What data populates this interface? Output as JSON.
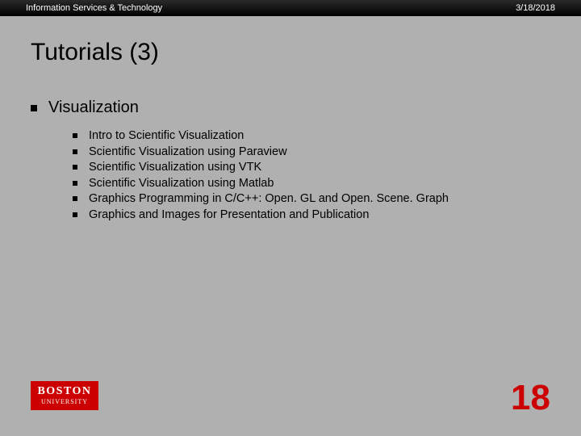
{
  "header": {
    "left": "Information Services & Technology",
    "right": "3/18/2018"
  },
  "title": "Tutorials (3)",
  "section": {
    "heading": "Visualization",
    "items": [
      "Intro to Scientific Visualization",
      "Scientific Visualization using Paraview",
      "Scientific Visualization using VTK",
      "Scientific Visualization using Matlab",
      "Graphics Programming in C/C++: Open. GL and Open. Scene. Graph",
      "Graphics and Images for Presentation and Publication"
    ]
  },
  "logo": {
    "line1": "BOSTON",
    "line2": "UNIVERSITY"
  },
  "page_number": "18"
}
